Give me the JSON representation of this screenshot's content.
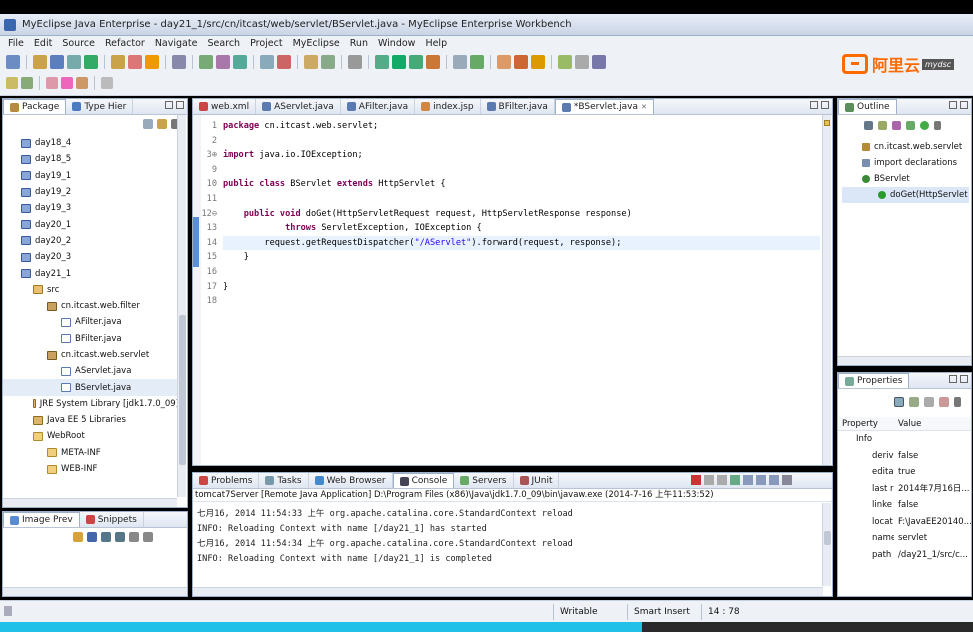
{
  "window": {
    "title": "MyEclipse Java Enterprise - day21_1/src/cn/itcast/web/servlet/BServlet.java - MyEclipse Enterprise Workbench"
  },
  "menu": [
    "File",
    "Edit",
    "Source",
    "Refactor",
    "Navigate",
    "Search",
    "Project",
    "MyEclipse",
    "Run",
    "Window",
    "Help"
  ],
  "logo": {
    "text": "阿里云",
    "badge": "mydsc"
  },
  "package_explorer": {
    "tabs": [
      "Package",
      "Type Hier"
    ],
    "tree": [
      {
        "label": "day18_4",
        "type": "proj"
      },
      {
        "label": "day18_5",
        "type": "proj"
      },
      {
        "label": "day19_1",
        "type": "proj"
      },
      {
        "label": "day19_2",
        "type": "proj"
      },
      {
        "label": "day19_3",
        "type": "proj"
      },
      {
        "label": "day20_1",
        "type": "proj"
      },
      {
        "label": "day20_2",
        "type": "proj"
      },
      {
        "label": "day20_3",
        "type": "proj"
      },
      {
        "label": "day21_1",
        "type": "proj"
      },
      {
        "label": "src",
        "type": "src"
      },
      {
        "label": "cn.itcast.web.filter",
        "type": "pkg"
      },
      {
        "label": "AFilter.java",
        "type": "java"
      },
      {
        "label": "BFilter.java",
        "type": "java"
      },
      {
        "label": "cn.itcast.web.servlet",
        "type": "pkg"
      },
      {
        "label": "AServlet.java",
        "type": "java"
      },
      {
        "label": "BServlet.java",
        "type": "java"
      },
      {
        "label": "JRE System Library [jdk1.7.0_09]",
        "type": "lib"
      },
      {
        "label": "Java EE 5 Libraries",
        "type": "lib"
      },
      {
        "label": "WebRoot",
        "type": "folder"
      },
      {
        "label": "META-INF",
        "type": "folder"
      },
      {
        "label": "WEB-INF",
        "type": "folder"
      }
    ]
  },
  "image_preview": {
    "tabs": [
      "Image Prev",
      "Snippets"
    ]
  },
  "editor": {
    "tabs": [
      "web.xml",
      "AServlet.java",
      "AFilter.java",
      "index.jsp",
      "BFilter.java",
      "*BServlet.java"
    ],
    "active_tab": 5,
    "lines": [
      {
        "n": "1",
        "segs": [
          {
            "t": "package",
            "c": "kw"
          },
          {
            "t": " cn.itcast.web.servlet;",
            "c": ""
          }
        ]
      },
      {
        "n": "2",
        "segs": []
      },
      {
        "n": "3⊕",
        "segs": [
          {
            "t": "import",
            "c": "kw"
          },
          {
            "t": " java.io.IOException;",
            "c": ""
          }
        ]
      },
      {
        "n": "9",
        "segs": []
      },
      {
        "n": "10",
        "segs": [
          {
            "t": "public class",
            "c": "kw"
          },
          {
            "t": " BServlet ",
            "c": ""
          },
          {
            "t": "extends",
            "c": "kw"
          },
          {
            "t": " HttpServlet {",
            "c": ""
          }
        ]
      },
      {
        "n": "11",
        "segs": []
      },
      {
        "n": "12⊖",
        "segs": [
          {
            "t": "    ",
            "c": ""
          },
          {
            "t": "public void",
            "c": "kw"
          },
          {
            "t": " doGet(HttpServletRequest request, HttpServletResponse response)",
            "c": ""
          }
        ]
      },
      {
        "n": "13",
        "segs": [
          {
            "t": "            ",
            "c": ""
          },
          {
            "t": "throws",
            "c": "kw"
          },
          {
            "t": " ServletException, IOException {",
            "c": ""
          }
        ]
      },
      {
        "n": "14",
        "segs": [
          {
            "t": "        request.getRequestDispatcher(",
            "c": ""
          },
          {
            "t": "\"/AServlet\"",
            "c": "str"
          },
          {
            "t": ").forward(request, response);",
            "c": ""
          }
        ],
        "hl": true
      },
      {
        "n": "15",
        "segs": [
          {
            "t": "    }",
            "c": ""
          }
        ]
      },
      {
        "n": "16",
        "segs": []
      },
      {
        "n": "17",
        "segs": [
          {
            "t": "}",
            "c": ""
          }
        ]
      },
      {
        "n": "18",
        "segs": []
      }
    ]
  },
  "console": {
    "tabs": [
      "Problems",
      "Tasks",
      "Web Browser",
      "Console",
      "Servers",
      "JUnit"
    ],
    "header": "tomcat7Server [Remote Java Application] D:\\Program Files (x86)\\Java\\jdk1.7.0_09\\bin\\javaw.exe (2014-7-16 上午11:53:52)",
    "lines": [
      "七月16, 2014 11:54:33 上午 org.apache.catalina.core.StandardContext reload",
      "INFO: Reloading Context with name [/day21_1] has started",
      "七月16, 2014 11:54:34 上午 org.apache.catalina.core.StandardContext reload",
      "INFO: Reloading Context with name [/day21_1] is completed"
    ]
  },
  "outline": {
    "tab": "Outline",
    "items": [
      {
        "label": "cn.itcast.web.servlet",
        "icon": "package-icon"
      },
      {
        "label": "import declarations",
        "icon": "import-icon"
      },
      {
        "label": "BServlet",
        "icon": "class-icon"
      },
      {
        "label": "doGet(HttpServlet",
        "icon": "method-icon",
        "selected": true
      }
    ]
  },
  "properties": {
    "tab": "Properties",
    "columns": [
      "Property",
      "Value"
    ],
    "category": "Info",
    "rows": [
      {
        "k": "deriv",
        "v": "false"
      },
      {
        "k": "edita",
        "v": "true"
      },
      {
        "k": "last r",
        "v": "2014年7月16日..."
      },
      {
        "k": "linke",
        "v": "false"
      },
      {
        "k": "locat",
        "v": "F:\\JavaEE20140..."
      },
      {
        "k": "name",
        "v": "servlet"
      },
      {
        "k": "path",
        "v": "/day21_1/src/c..."
      }
    ]
  },
  "status": {
    "writable": "Writable",
    "insert_mode": "Smart Insert",
    "position": "14 : 78"
  },
  "progress": {
    "fraction": 0.66
  },
  "colors": {
    "accent": "#21c0e8",
    "logo": "#ff6a00",
    "keyword": "#7f0055",
    "string": "#2a00ff"
  }
}
